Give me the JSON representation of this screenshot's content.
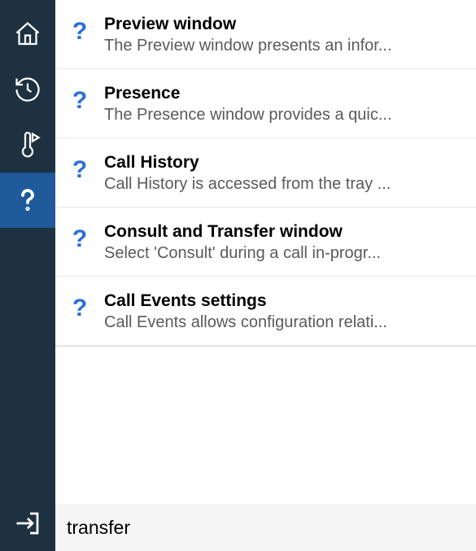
{
  "sidebar": {
    "items": [
      {
        "name": "home"
      },
      {
        "name": "history"
      },
      {
        "name": "thermometer"
      },
      {
        "name": "help",
        "active": true
      }
    ],
    "bottom": {
      "name": "exit"
    }
  },
  "results": [
    {
      "icon": "?",
      "title": "Preview window",
      "desc": "The Preview window presents an infor..."
    },
    {
      "icon": "?",
      "title": "Presence",
      "desc": "The Presence window provides a quic..."
    },
    {
      "icon": "?",
      "title": "Call History",
      "desc": "Call History is accessed from the tray ..."
    },
    {
      "icon": "?",
      "title": "Consult and Transfer window",
      "desc": "Select 'Consult' during a call in-progr..."
    },
    {
      "icon": "?",
      "title": "Call Events settings",
      "desc": "Call Events allows configuration relati..."
    }
  ],
  "search": {
    "value": "transfer"
  }
}
